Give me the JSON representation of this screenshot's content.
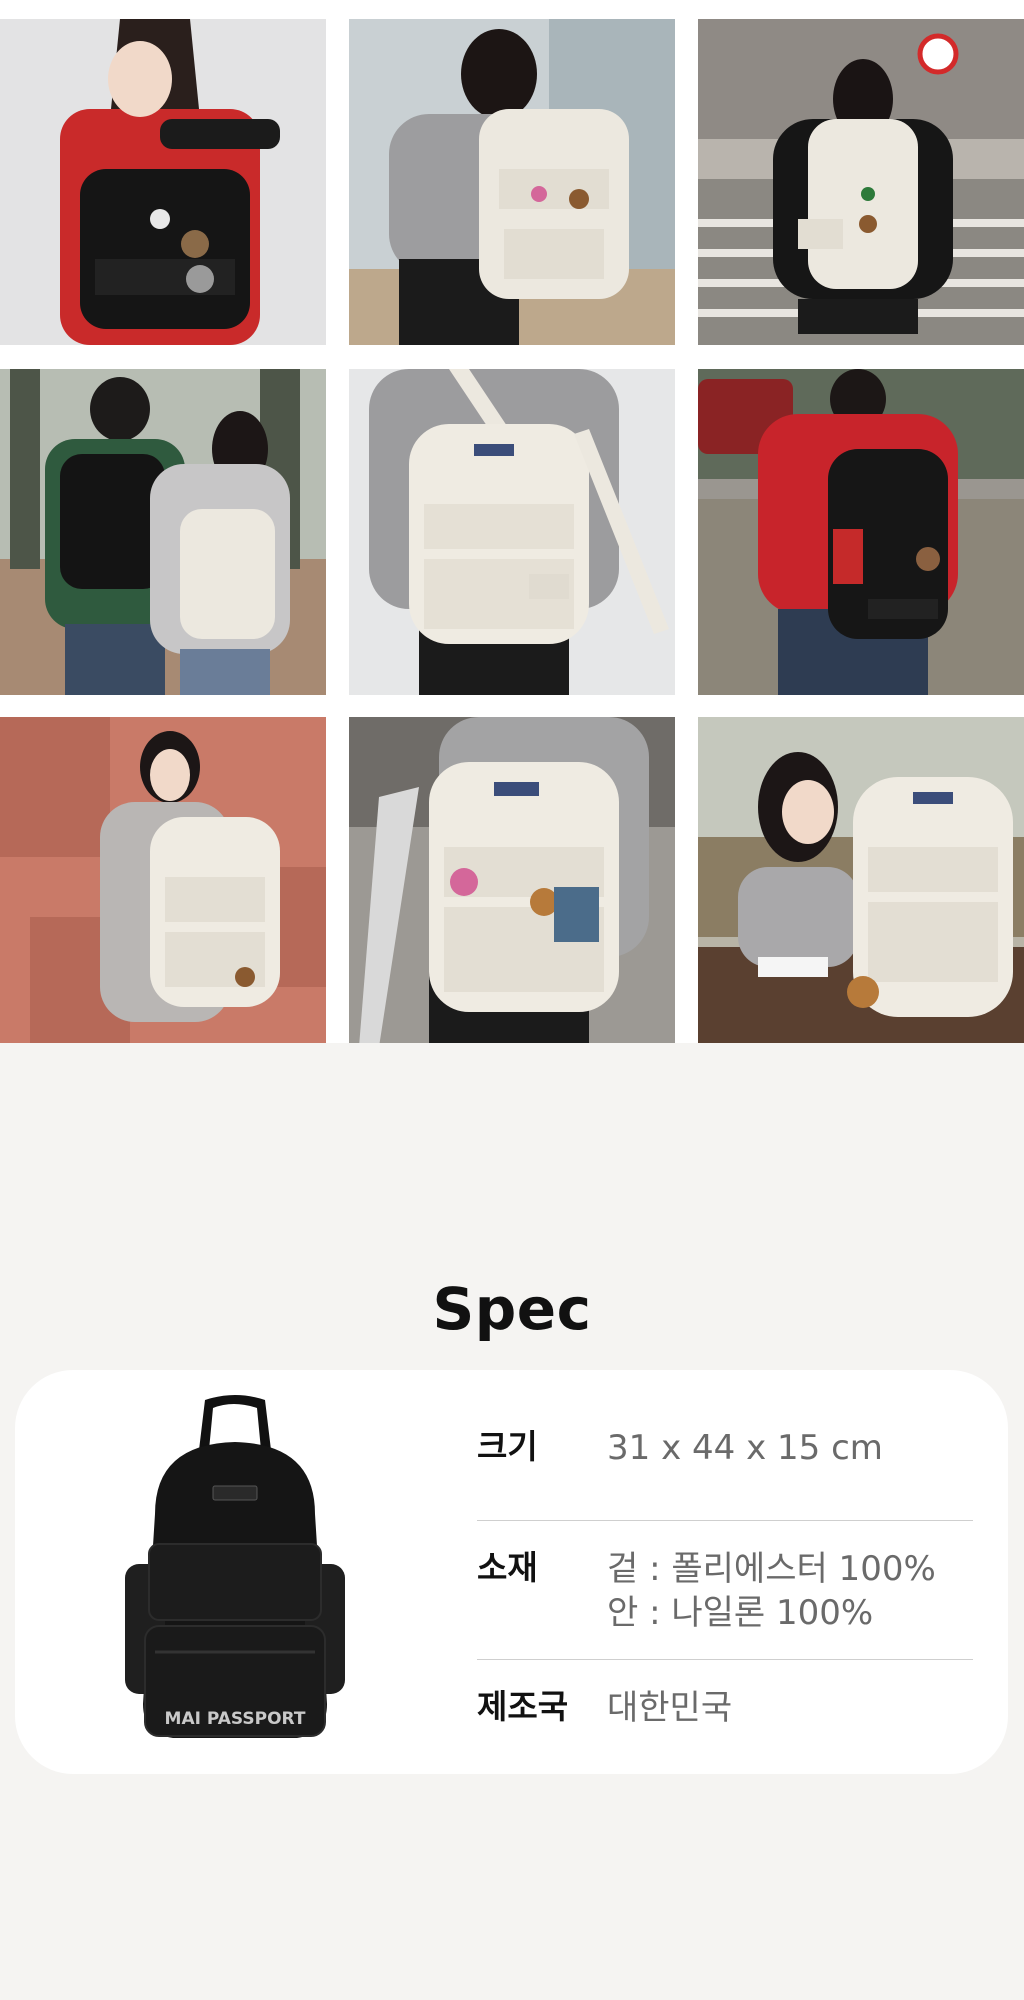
{
  "gallery": {
    "photos": [
      {
        "alt": "black-backpack-red-jersey"
      },
      {
        "alt": "white-backpack-grey-sweater"
      },
      {
        "alt": "white-backpack-street-crossing"
      },
      {
        "alt": "couple-black-white-backpacks"
      },
      {
        "alt": "white-backpack-closeup"
      },
      {
        "alt": "black-backpack-red-jersey-back"
      },
      {
        "alt": "white-backpack-red-wall"
      },
      {
        "alt": "white-backpack-keychains-scooter"
      },
      {
        "alt": "white-backpack-on-table"
      }
    ]
  },
  "spec": {
    "title": "Spec",
    "brand_text": "MAI PASSPORT",
    "rows": [
      {
        "label": "크기",
        "values": [
          "31 x 44 x 15 cm"
        ]
      },
      {
        "label": "소재",
        "values": [
          "겉 : 폴리에스터 100%",
          "안 : 나일론 100%"
        ]
      },
      {
        "label": "제조국",
        "values": [
          "대한민국"
        ]
      }
    ]
  },
  "colors": {
    "page_bg": "#f5f4f2",
    "card_bg": "#ffffff",
    "backpack_black": "#151515",
    "backpack_cream": "#ece8df"
  }
}
